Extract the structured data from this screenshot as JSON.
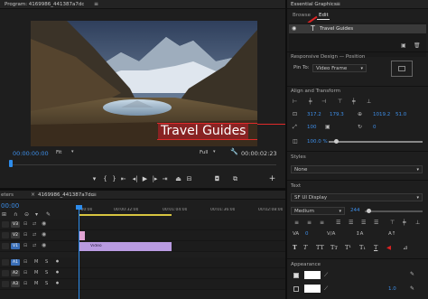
{
  "program": {
    "title": "Program: 4169986_441387a7dc",
    "menu_icon": "hamburger-icon",
    "timecode_current": "00:00:00:00",
    "fit_label": "Fit",
    "full_label": "Full",
    "timecode_duration": "00:00:02:23",
    "overlay_text": "Travel Guides",
    "wrench_icon": "wrench-icon",
    "add_icon": "plus-icon"
  },
  "essential_graphics": {
    "title": "Essential Graphics",
    "menu_icon": "hamburger-icon",
    "tabs": [
      {
        "label": "Browse"
      },
      {
        "label": "Edit"
      }
    ],
    "layer": {
      "name": "Travel Guides"
    },
    "responsive_design": {
      "title": "Responsive Design — Position",
      "pin_to_label": "Pin To:",
      "pin_to_value": "Video Frame"
    },
    "align": {
      "title": "Align and Transform",
      "pos_x": "317.2",
      "pos_y": "179.3",
      "anchor_x": "1019.2",
      "anchor_y": "51.0",
      "scale": "100",
      "rotation": "0",
      "opacity": "100.0 %"
    },
    "styles": {
      "title": "Styles",
      "value": "None"
    },
    "text": {
      "title": "Text",
      "font": "SF UI Display",
      "weight": "Medium",
      "size": "244"
    },
    "appearance": {
      "title": "Appearance",
      "fill_color": "#ffffff",
      "stroke_color": "#ffffff"
    }
  },
  "timeline": {
    "title": "4169986_441387a7dc",
    "meters_label": "eters",
    "timecode": "00:00",
    "ruler_labels": [
      ":00:00",
      "00:00:32:00",
      "00:01:04:00",
      "00:01:36:00",
      "00:02:08:00"
    ],
    "tracks": [
      {
        "name": "V3"
      },
      {
        "name": "V2"
      },
      {
        "name": "V1"
      },
      {
        "name": "A1",
        "m": "M",
        "s": "S"
      },
      {
        "name": "A2",
        "m": "M",
        "s": "S"
      },
      {
        "name": "A3",
        "m": "M",
        "s": "S"
      }
    ],
    "clip_label": "Video",
    "playhead_position": 0.0
  },
  "colors": {
    "accent": "#2d8ceb",
    "clip_purple": "#b89ae0",
    "clip_pink": "#e0a3d3",
    "track_active": "#3a6fb8",
    "overlay_red": "#c0202a"
  }
}
